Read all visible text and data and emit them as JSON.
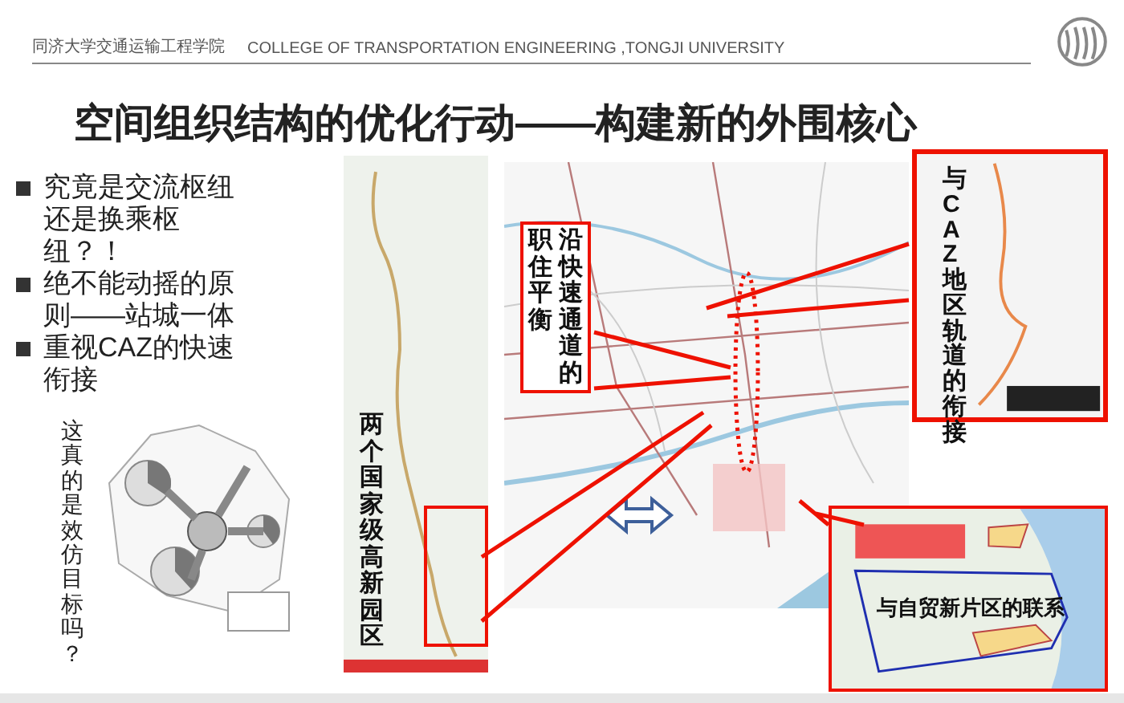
{
  "header": {
    "school_cn": "同济大学交通运输工程学院",
    "school_en": "COLLEGE OF TRANSPORTATION ENGINEERING ,TONGJI UNIVERSITY"
  },
  "title": "空间组织结构的优化行动——构建新的外围核心",
  "bullets": [
    "究竟是交流枢纽还是换乘枢纽？！",
    "绝不能动摇的原则——站城一体",
    "重视CAZ的快速衔接"
  ],
  "side_question": "这真的是效仿目标吗？",
  "figure": {
    "corridor_label_right": "沿快速通道的",
    "corridor_label_left": "职住平衡",
    "parks_label": "两个国家级高新园区",
    "caz_label": "与CAZ地区轨道的衔接",
    "ftz_label": "与自贸新片区的联系"
  }
}
